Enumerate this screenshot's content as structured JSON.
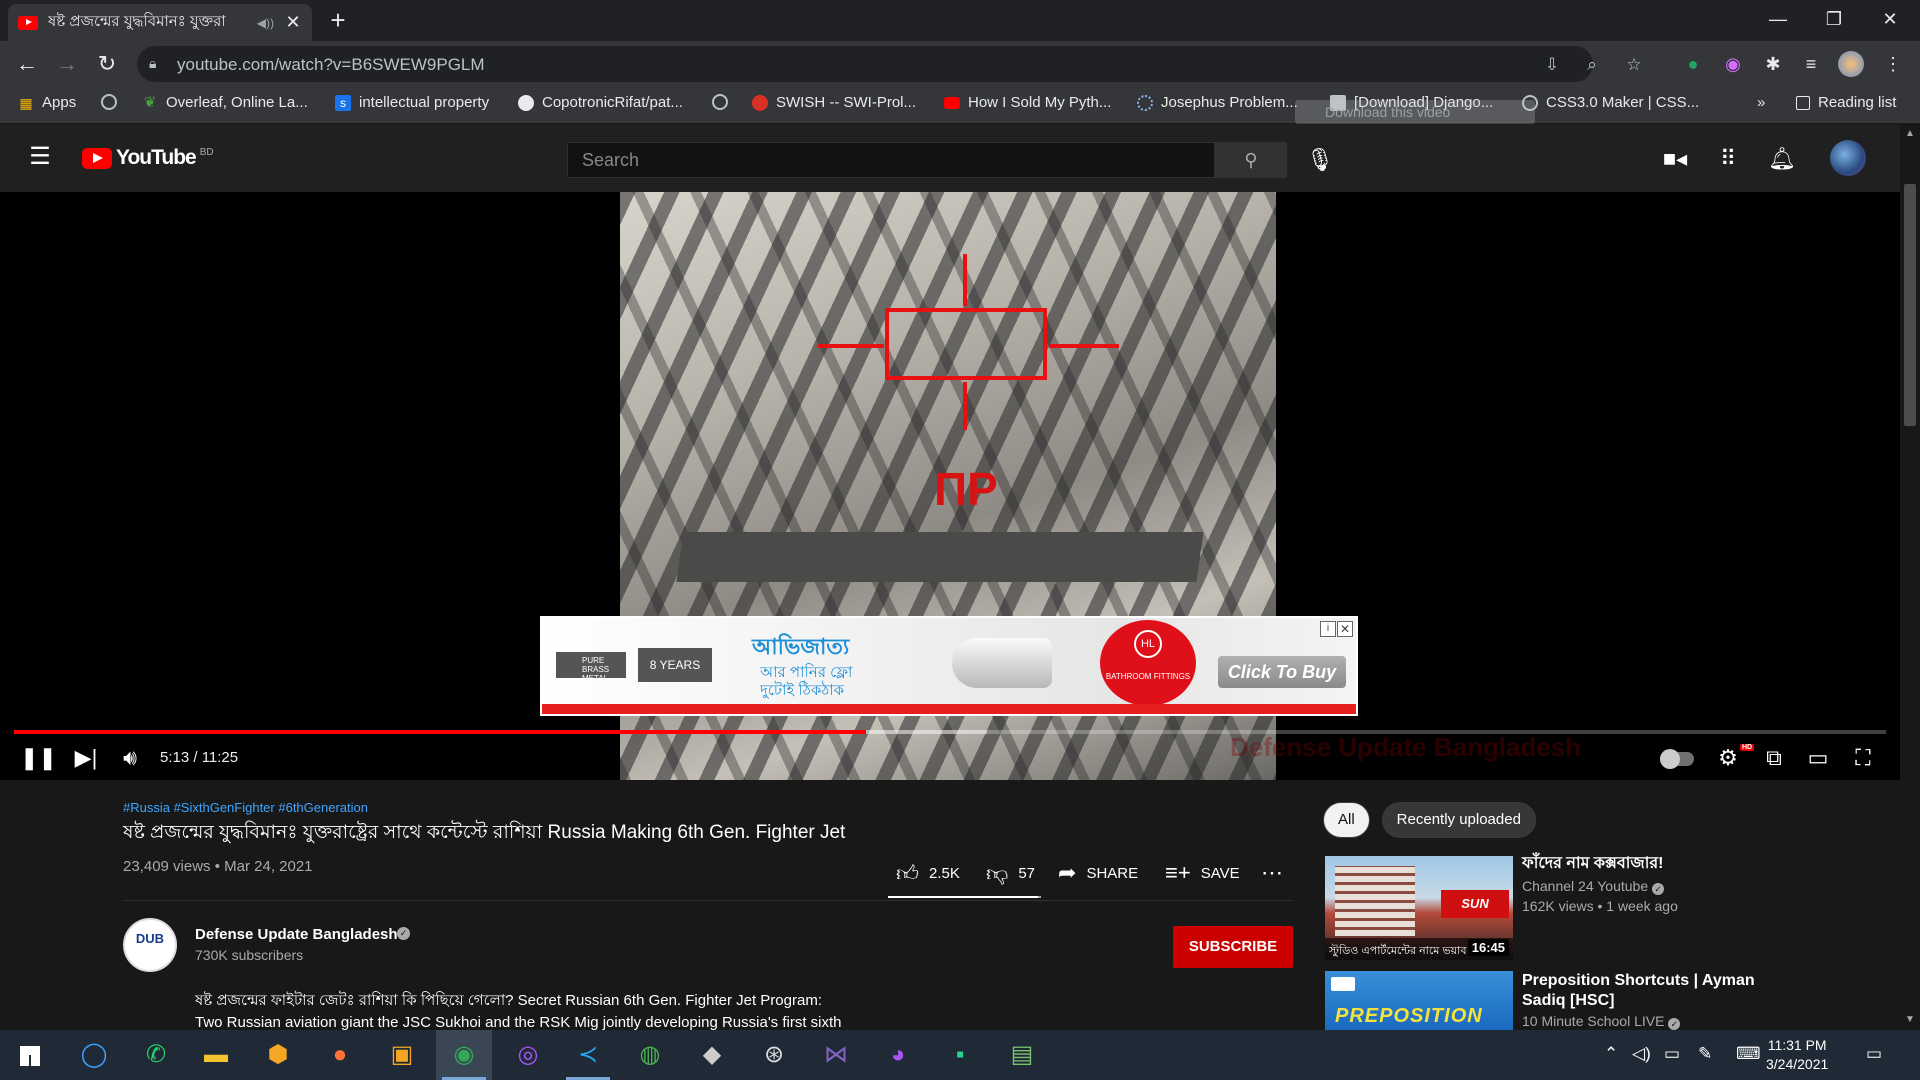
{
  "browser": {
    "tab": {
      "title": "ষষ্ট প্রজন্মের যুদ্ধবিমানঃ যুক্তরা",
      "close_glyph": "✕"
    },
    "new_tab_glyph": "+",
    "window_controls": {
      "minimize": "—",
      "restore": "❐",
      "close": "✕"
    },
    "url": "youtube.com/watch?v=B6SWEW9PGLM",
    "bookmarks": [
      {
        "label": "Apps",
        "icon": "apps-grid-icon",
        "color": "#f4b400"
      },
      {
        "label": "",
        "icon": "globe-icon",
        "color": "#bdc1c6"
      },
      {
        "label": "Overleaf, Online La...",
        "icon": "overleaf-icon",
        "color": "#47a141"
      },
      {
        "label": "intellectual property",
        "icon": "scribd-icon",
        "color": "#1a73e8"
      },
      {
        "label": "CopotronicRifat/pat...",
        "icon": "github-icon",
        "color": "#e8eaed"
      },
      {
        "label": "",
        "icon": "globe-icon",
        "color": "#bdc1c6"
      },
      {
        "label": "SWISH -- SWI-Prol...",
        "icon": "swish-icon",
        "color": "#d93025"
      },
      {
        "label": "How I Sold My Pyth...",
        "icon": "youtube-icon",
        "color": "#ff0000"
      },
      {
        "label": "Josephus Problem...",
        "icon": "loading-icon",
        "color": "#8ab4f8"
      },
      {
        "label": "[Download] Django...",
        "icon": "page-icon",
        "color": "#bdc1c6"
      },
      {
        "label": "CSS3.0 Maker | CSS...",
        "icon": "globe-icon",
        "color": "#bdc1c6"
      }
    ],
    "bookmarks_overflow": "»",
    "reading_list": "Reading list",
    "download_overlay": "Download this video"
  },
  "youtube": {
    "logo_text": "YouTube",
    "country_code": "BD",
    "search_placeholder": "Search",
    "player": {
      "watermark": "Defense Update Bangladesh",
      "overlay_text": "ПР",
      "time": "5:13 / 11:25",
      "played_fraction": 0.4553,
      "loaded_fraction": 0.52,
      "ad": {
        "brass": "PURE BRASS METAL",
        "years": "8 YEARS",
        "headline": "আভিজাত্য",
        "tagline_1": "আর পানির ফ্লো",
        "tagline_2": "দুটোই ঠিকঠাক",
        "brand": "BATHROOM FITTINGS",
        "brand_mark": "HL",
        "cta": "Click To Buy",
        "info_glyph": "i",
        "close_glyph": "✕"
      }
    },
    "video": {
      "hashtags": "#Russia #SixthGenFighter #6thGeneration",
      "title": "ষষ্ট প্রজন্মের যুদ্ধবিমানঃ যুক্তরাষ্ট্রের সাথে কন্টেস্টে রাশিয়া Russia Making 6th Gen. Fighter Jet",
      "views_date": "23,409 views • Mar 24, 2021",
      "likes": "2.5K",
      "dislikes": "57",
      "share": "SHARE",
      "save": "SAVE",
      "like_ratio": 0.978
    },
    "channel": {
      "name": "Defense Update Bangladesh",
      "subscribers": "730K subscribers",
      "avatar_text": "DUB",
      "subscribe": "SUBSCRIBE",
      "description_1": "ষষ্ট প্রজন্মের ফাইটার জেটঃ রাশিয়া কি পিছিয়ে গেলো? Secret Russian 6th Gen. Fighter Jet Program:",
      "description_2": "Two Russian aviation giant the JSC Sukhoi and the RSK Mig jointly developing Russia's first sixth"
    },
    "chips": [
      "All",
      "Recently uploaded"
    ],
    "recommendations": [
      {
        "title": "ফাঁদের নাম কক্সবাজার!",
        "channel": "Channel 24 Youtube",
        "meta": "162K views • 1 week ago",
        "duration": "16:45",
        "thumb_caption": "স্টুডিও এপার্টমেন্টের নামে ভয়াব"
      },
      {
        "title": "Preposition Shortcuts | Ayman Sadiq [HSC]",
        "channel": "10 Minute School LIVE",
        "meta": "",
        "duration": "",
        "thumb_caption": "PREPOSITION"
      }
    ]
  },
  "taskbar": {
    "clock_time": "11:31 PM",
    "clock_date": "3/24/2021"
  }
}
